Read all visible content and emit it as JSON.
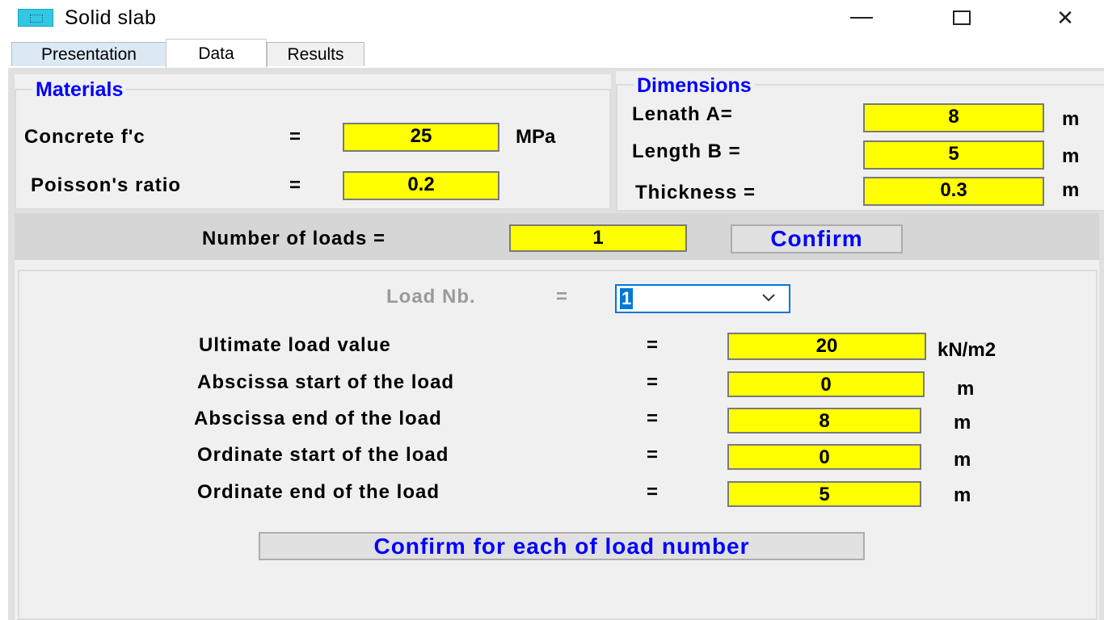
{
  "window": {
    "title": "Solid slab",
    "minimize_icon": "minimize-icon",
    "maximize_icon": "maximize-icon",
    "close_icon": "close-icon",
    "close_glyph": "✕"
  },
  "tabs": [
    {
      "label": "Presentation"
    },
    {
      "label": "Data"
    },
    {
      "label": "Results"
    }
  ],
  "materials": {
    "title": "Materials",
    "concrete_label": "Concrete  f'c",
    "concrete_eq": "=",
    "concrete_value": "25",
    "concrete_unit": "MPa",
    "poisson_label": "Poisson's ratio",
    "poisson_eq": "=",
    "poisson_value": "0.2"
  },
  "dimensions": {
    "title": "Dimensions",
    "length_a_label": "Lenath A=",
    "length_a_value": "8",
    "length_a_unit": "m",
    "length_b_label": "Length B =",
    "length_b_value": "5",
    "length_b_unit": "m",
    "thickness_label": "Thickness =",
    "thickness_value": "0.3",
    "thickness_unit": "m"
  },
  "loads": {
    "number_label": "Number of loads =",
    "number_value": "1",
    "confirm_label": "Confirm"
  },
  "load_detail": {
    "load_nb_label": "Load Nb.",
    "load_nb_eq": "=",
    "load_nb_value": "1",
    "rows": [
      {
        "label": "Ultimate load value",
        "eq": "=",
        "value": "20",
        "unit": "kN/m2"
      },
      {
        "label": "Abscissa start of the load",
        "eq": "=",
        "value": "0",
        "unit": "m"
      },
      {
        "label": "Abscissa end of the load",
        "eq": "=",
        "value": "8",
        "unit": "m"
      },
      {
        "label": "Ordinate start of the load",
        "eq": "=",
        "value": "0",
        "unit": "m"
      },
      {
        "label": "Ordinate end of the load",
        "eq": "=",
        "value": "5",
        "unit": "m"
      }
    ],
    "confirm_each_label": "Confirm for each of load number"
  },
  "colors": {
    "field_bg": "#ffff00",
    "accent_text": "#0000ff",
    "selection": "#0078d7"
  }
}
